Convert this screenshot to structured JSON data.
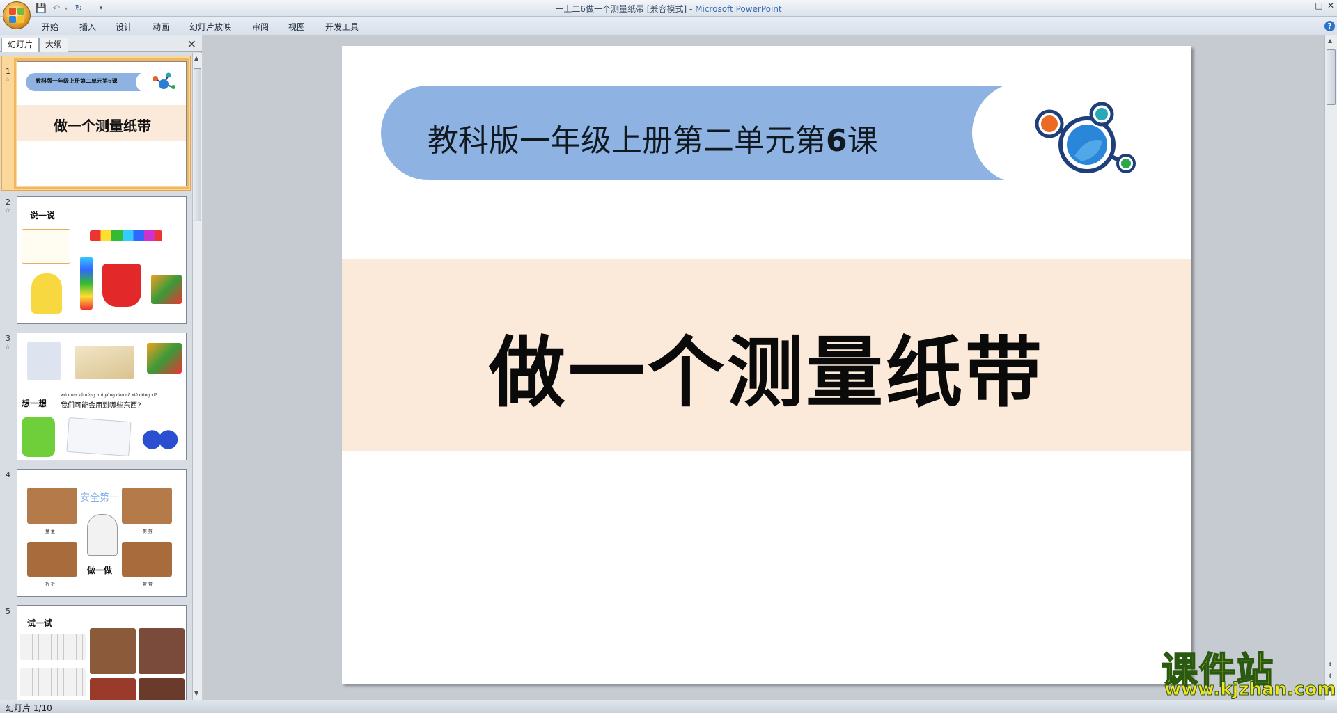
{
  "window": {
    "title_doc": "一上二6做一个测量纸带 [兼容模式] - ",
    "title_app": "Microsoft PowerPoint",
    "controls": [
      "–",
      "□",
      "✕"
    ]
  },
  "ribbon": {
    "tabs": [
      "开始",
      "插入",
      "设计",
      "动画",
      "幻灯片放映",
      "审阅",
      "视图",
      "开发工具"
    ]
  },
  "left_panel": {
    "tabs": [
      "幻灯片",
      "大纲"
    ],
    "close": "✕",
    "thumbnails": [
      {
        "num": "1",
        "banner": "教科版一年级上册第二单元第6课",
        "title": "做一个测量纸带"
      },
      {
        "num": "2",
        "heading": "说一说"
      },
      {
        "num": "3",
        "heading": "想一想",
        "pinyin": "wǒ men kě néng huì yòng dào nǎ xiē dōng xi?",
        "question": "我们可能会用到哪些东西?"
      },
      {
        "num": "4",
        "heading": "做一做",
        "caption": "安全第一",
        "labels": [
          "量 量",
          "剪 剪",
          "折 折",
          "带 带"
        ]
      },
      {
        "num": "5",
        "heading": "试一试"
      }
    ]
  },
  "slide": {
    "subtitle_prefix": "教科版一年级上册第二单元第",
    "subtitle_number": "6",
    "subtitle_suffix": "课",
    "title": "做一个测量纸带",
    "colors": {
      "banner": "#8eb3e2",
      "band": "#fbe9da"
    }
  },
  "status": {
    "slide_count": "幻灯片 1/10"
  },
  "watermark": {
    "name": "课件站",
    "url": "www.kjzhan.com"
  }
}
